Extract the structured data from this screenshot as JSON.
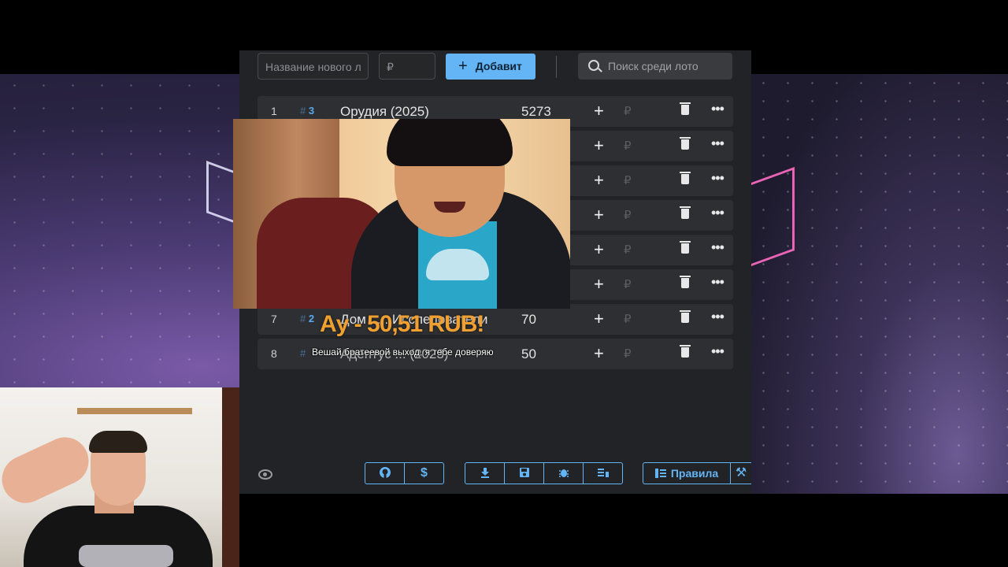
{
  "toolbar": {
    "name_placeholder": "Название нового л",
    "price_placeholder": "₽",
    "add_label": "Добавит",
    "search_placeholder": "Поиск среди лото"
  },
  "lots": [
    {
      "num": "1",
      "tag": "3",
      "name": "Орудия (2025)",
      "amount": "5273"
    },
    {
      "num": "",
      "tag": "",
      "name": "",
      "amount": ""
    },
    {
      "num": "",
      "tag": "",
      "name": "",
      "amount": ""
    },
    {
      "num": "",
      "tag": "",
      "name": "",
      "amount": ""
    },
    {
      "num": "",
      "tag": "",
      "name": "",
      "amount": ""
    },
    {
      "num": "",
      "tag": "",
      "name": "",
      "amount": ""
    },
    {
      "num": "7",
      "tag": "2",
      "name": "Дом ... : Исследователи",
      "amount": "70"
    },
    {
      "num": "8",
      "tag": "",
      "name": "Адептус ... (2023)",
      "amount": "50"
    }
  ],
  "row_icons": {
    "plus": "+",
    "rub": "₽",
    "dots": "•••"
  },
  "donation": {
    "headline": "Ау - 50,51 RUB!",
    "message": "Вешай братеевой выход, я тебе доверяю"
  },
  "footer": {
    "rules_label": "Правила",
    "icons": [
      "github-icon",
      "dollar-icon",
      "download-icon",
      "save-icon",
      "bug-icon",
      "clear-list-icon",
      "eye-icon"
    ]
  },
  "colors": {
    "accent": "#64b5f6",
    "donation": "#f0a030",
    "panel": "#222326",
    "row": "#2e2f32"
  }
}
